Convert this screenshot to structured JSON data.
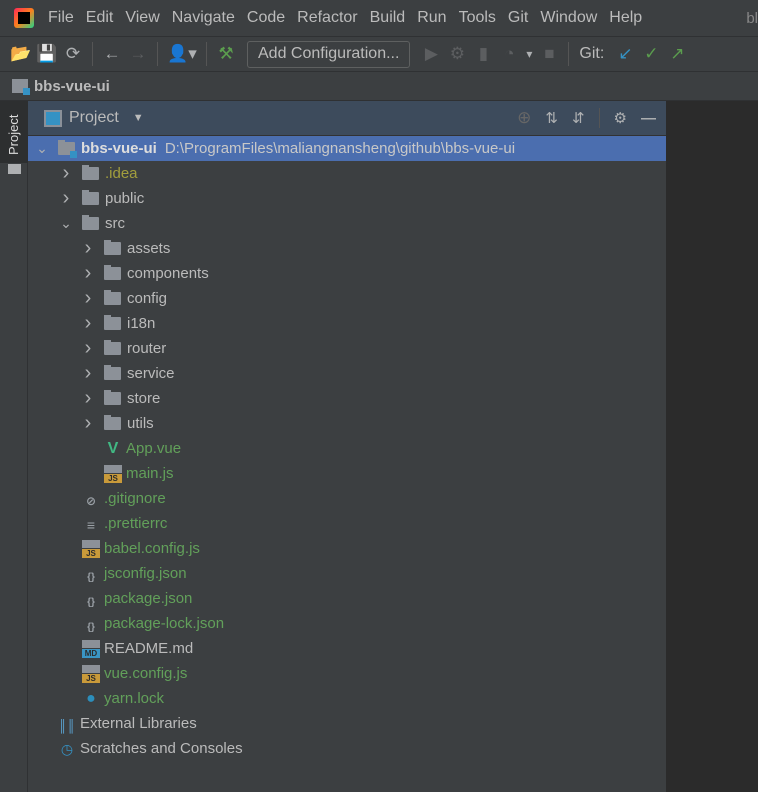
{
  "menubar": {
    "items": [
      "File",
      "Edit",
      "View",
      "Navigate",
      "Code",
      "Refactor",
      "Build",
      "Run",
      "Tools",
      "Git",
      "Window",
      "Help"
    ],
    "title_fragment": "bl"
  },
  "toolbar": {
    "add_configuration": "Add Configuration...",
    "git_label": "Git:"
  },
  "breadcrumb": {
    "project": "bbs-vue-ui"
  },
  "side_stripe": {
    "label": "Project"
  },
  "panel": {
    "title": "Project"
  },
  "colors": {
    "accent_selected": "#4b6eaf",
    "vcs_added": "#62a05a",
    "ignored": "#a29e3d",
    "editor_bg": "#2b2b2b"
  },
  "tree": [
    {
      "label": "bbs-vue-ui",
      "path": "D:\\ProgramFiles\\maliangnansheng\\github\\bbs-vue-ui",
      "level": 0,
      "kind": "module",
      "expanded": true,
      "color": "gray",
      "selected": true
    },
    {
      "label": ".idea",
      "level": 1,
      "kind": "folder",
      "expanded": false,
      "color": "olive"
    },
    {
      "label": "public",
      "level": 1,
      "kind": "folder",
      "expanded": false,
      "color": "gray"
    },
    {
      "label": "src",
      "level": 1,
      "kind": "folder",
      "expanded": true,
      "color": "gray"
    },
    {
      "label": "assets",
      "level": 2,
      "kind": "folder",
      "expanded": false,
      "color": "gray"
    },
    {
      "label": "components",
      "level": 2,
      "kind": "folder",
      "expanded": false,
      "color": "gray"
    },
    {
      "label": "config",
      "level": 2,
      "kind": "folder",
      "expanded": false,
      "color": "gray"
    },
    {
      "label": "i18n",
      "level": 2,
      "kind": "folder",
      "expanded": false,
      "color": "gray"
    },
    {
      "label": "router",
      "level": 2,
      "kind": "folder",
      "expanded": false,
      "color": "gray"
    },
    {
      "label": "service",
      "level": 2,
      "kind": "folder",
      "expanded": false,
      "color": "gray"
    },
    {
      "label": "store",
      "level": 2,
      "kind": "folder",
      "expanded": false,
      "color": "gray"
    },
    {
      "label": "utils",
      "level": 2,
      "kind": "folder",
      "expanded": false,
      "color": "gray"
    },
    {
      "label": "App.vue",
      "level": 2,
      "kind": "vue",
      "color": "green"
    },
    {
      "label": "main.js",
      "level": 2,
      "kind": "js",
      "color": "green"
    },
    {
      "label": ".gitignore",
      "level": 1,
      "kind": "ignore",
      "color": "green"
    },
    {
      "label": ".prettierrc",
      "level": 1,
      "kind": "text",
      "color": "green"
    },
    {
      "label": "babel.config.js",
      "level": 1,
      "kind": "js",
      "color": "green"
    },
    {
      "label": "jsconfig.json",
      "level": 1,
      "kind": "json",
      "color": "green"
    },
    {
      "label": "package.json",
      "level": 1,
      "kind": "json",
      "color": "green"
    },
    {
      "label": "package-lock.json",
      "level": 1,
      "kind": "json",
      "color": "green"
    },
    {
      "label": "README.md",
      "level": 1,
      "kind": "md",
      "color": "gray"
    },
    {
      "label": "vue.config.js",
      "level": 1,
      "kind": "js",
      "color": "green"
    },
    {
      "label": "yarn.lock",
      "level": 1,
      "kind": "yarn",
      "color": "green"
    },
    {
      "label": "External Libraries",
      "level": 0,
      "kind": "libraries",
      "color": "gray"
    },
    {
      "label": "Scratches and Consoles",
      "level": 0,
      "kind": "scratches",
      "color": "gray"
    }
  ]
}
